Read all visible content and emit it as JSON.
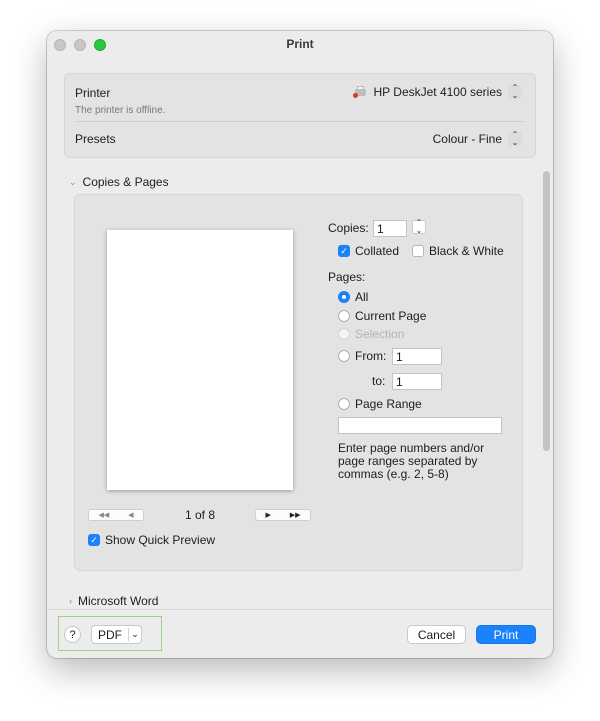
{
  "window": {
    "title": "Print"
  },
  "printer_panel": {
    "printer_label": "Printer",
    "printer_value": "HP DeskJet 4100 series",
    "printer_status": "The printer is offline.",
    "presets_label": "Presets",
    "presets_value": "Colour - Fine"
  },
  "copies_section": {
    "header": "Copies & Pages",
    "copies_label": "Copies:",
    "copies_value": "1",
    "collated_label": "Collated",
    "collated_checked": true,
    "bw_label": "Black & White",
    "bw_checked": false,
    "pages_label": "Pages:",
    "options": {
      "all": "All",
      "current": "Current Page",
      "selection": "Selection",
      "from": "From:",
      "to": "to:",
      "range": "Page Range"
    },
    "from_value": "1",
    "to_value": "1",
    "range_value": "",
    "help": "Enter page numbers and/or page ranges separated by commas (e.g. 2, 5-8)",
    "page_indicator": "1 of 8",
    "quick_preview_label": "Show Quick Preview",
    "quick_preview_checked": true
  },
  "next_section": {
    "header": "Microsoft Word"
  },
  "bottom": {
    "help": "?",
    "pdf": "PDF",
    "cancel": "Cancel",
    "print": "Print"
  },
  "colors": {
    "accent": "#1a82fb",
    "highlight": "#9fd08a",
    "offline_dot": "#e0342b"
  }
}
